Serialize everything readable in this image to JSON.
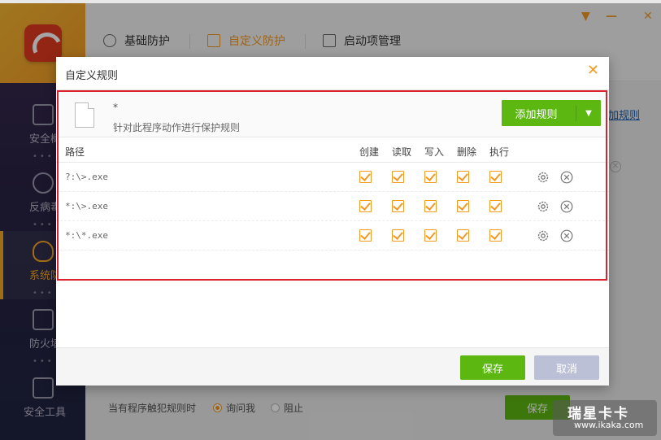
{
  "sidebar": {
    "items": [
      {
        "label": "安全概"
      },
      {
        "label": "反病毒"
      },
      {
        "label": "系统防"
      },
      {
        "label": "防火墙"
      },
      {
        "label": "安全工具"
      }
    ]
  },
  "tabs": [
    {
      "label": "基础防护"
    },
    {
      "label": "自定义防护"
    },
    {
      "label": "启动项管理"
    }
  ],
  "background": {
    "link": "加规则",
    "footer_text": "当有程序触犯规则时",
    "radio_ask": "询问我",
    "radio_block": "阻止",
    "save_label": "保存"
  },
  "dialog": {
    "title": "自定义规则",
    "close_glyph": "✕",
    "program_name": "*",
    "program_desc": "针对此程序动作进行保护规则",
    "add_rule_label": "添加规则",
    "add_rule_caret": "▼",
    "columns": {
      "path": "路径",
      "create": "创建",
      "read": "读取",
      "write": "写入",
      "delete": "删除",
      "execute": "执行"
    },
    "rows": [
      {
        "path": "?:\\>.exe"
      },
      {
        "path": "*:\\>.exe"
      },
      {
        "path": "*:\\*.exe"
      }
    ],
    "save_label": "保存",
    "cancel_label": "取消"
  },
  "watermark": {
    "cn": "瑞星卡卡",
    "url": "www.ikaka.com"
  },
  "colors": {
    "accent_orange": "#f29a24",
    "green": "#5cb711",
    "highlight_red": "#d9232e"
  }
}
